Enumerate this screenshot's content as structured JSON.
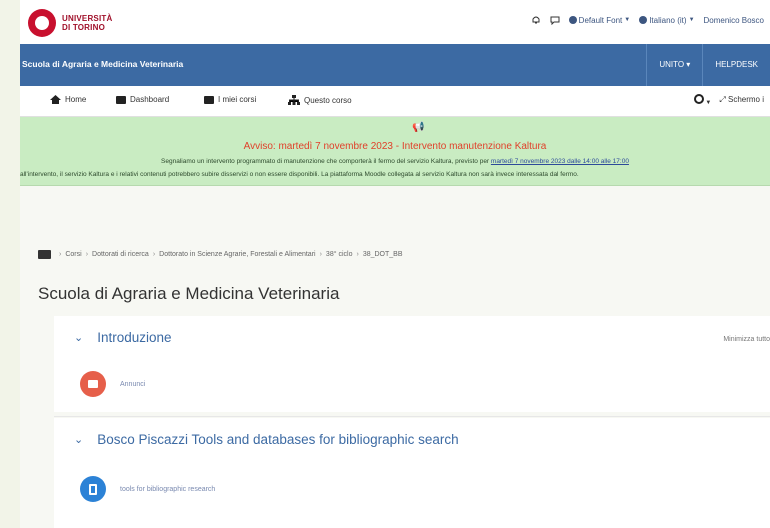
{
  "header": {
    "logo_text_line1": "UNIVERSITÀ",
    "logo_text_line2": "DI TORINO",
    "font_label": "Default Font",
    "language_label": "Italiano (it)",
    "user_label": "Domenico Bosco"
  },
  "bluenav": {
    "school": "Scuola di Agraria e Medicina Veterinaria",
    "items": [
      "UNITO",
      "HELPDESK"
    ]
  },
  "secmenu": {
    "items": [
      "Home",
      "Dashboard",
      "I miei corsi",
      "Questo corso"
    ],
    "fullscreen_label": "Schermo i"
  },
  "banner": {
    "title": "Avviso: martedì 7 novembre 2023 - Intervento manutenzione Kaltura",
    "line1_prefix": "Segnaliamo un intervento programmato di manutenzione che comporterà il fermo del servizio Kaltura, previsto per ",
    "line1_link": "martedì 7 novembre 2023 dalle 14:00 alle 17:00",
    "line2": "all'intervento, il servizio Kaltura e i relativi contenuti potrebbero subire disservizi o non essere disponibili. La piattaforma Moodle collegata al servizio Kaltura non sarà invece interessata dal fermo."
  },
  "breadcrumb": [
    "Corsi",
    "Dottorati di ricerca",
    "Dottorato in Scienze Agrarie, Forestali e Alimentari",
    "38° ciclo",
    "38_DOT_BB"
  ],
  "page_title": "Scuola di Agraria e Medicina Veterinaria",
  "sections": [
    {
      "title": "Introduzione",
      "minimize": "Minimizza tutto",
      "activity": "Annunci"
    },
    {
      "title": "Bosco Piscazzi Tools and databases for bibliographic search",
      "activity": "tools for bibliographic research"
    }
  ],
  "colors": {
    "brand_blue": "#3c6aa3",
    "banner_green": "#c9ecc2",
    "alert_red": "#e0402a"
  }
}
